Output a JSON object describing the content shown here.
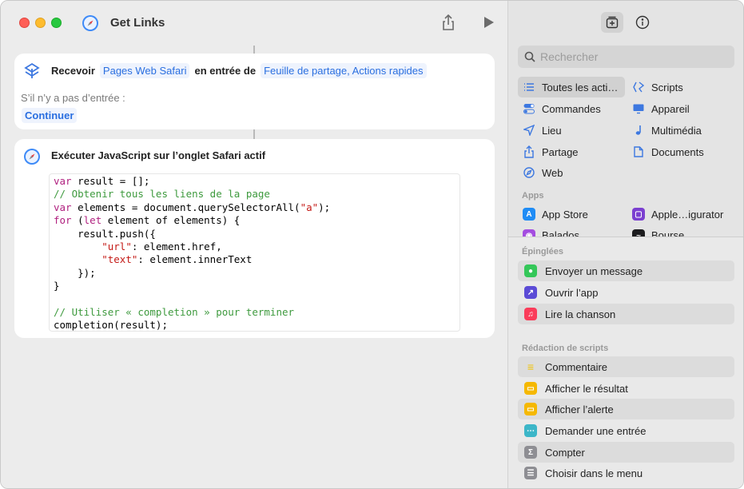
{
  "window": {
    "title": "Get Links"
  },
  "colors": {
    "accent": "#2a6fe0",
    "token_bg": "#eef3fd",
    "sidebar_bg": "#e4e4e4"
  },
  "toolbar": {
    "share_icon": "share-icon",
    "run_icon": "play-icon"
  },
  "receive_action": {
    "verb": "Recevoir",
    "input_types": "Pages Web Safari",
    "connector": "en entrée de",
    "sources": "Feuille de partage, Actions rapides",
    "no_input_label": "S’il n’y a pas d’entrée :",
    "no_input_action": "Continuer"
  },
  "js_action": {
    "title": "Exécuter JavaScript sur l’onglet Safari actif",
    "code": {
      "l1a": "var",
      "l1b": " result = [];",
      "l2": "// Obtenir tous les liens de la page",
      "l3a": "var",
      "l3b": " elements = document.querySelectorAll(",
      "l3c": "\"a\"",
      "l3d": ");",
      "l4a": "for",
      "l4b": " (",
      "l4c": "let",
      "l4d": " element of elements) {",
      "l5": "    result.push({",
      "l6a": "        ",
      "l6b": "\"url\"",
      "l6c": ": element.href,",
      "l7a": "        ",
      "l7b": "\"text\"",
      "l7c": ": element.innerText",
      "l8": "    });",
      "l9": "}",
      "l10": "",
      "l11": "// Utiliser « completion » pour terminer",
      "l12": "completion(result);"
    }
  },
  "sidebar": {
    "search_placeholder": "Rechercher",
    "categories_left": [
      "Toutes les acti…",
      "Commandes",
      "Lieu",
      "Partage",
      "Web"
    ],
    "categories_right": [
      "Scripts",
      "Appareil",
      "Multimédia",
      "Documents"
    ],
    "apps_label": "Apps",
    "apps": [
      "App Store",
      "Apple…igurator",
      "Balados",
      "Bourse"
    ],
    "pinned_label": "Épinglées",
    "pinned": [
      "Envoyer un message",
      "Ouvrir l’app",
      "Lire la chanson"
    ],
    "scripting_label": "Rédaction de scripts",
    "scripting": [
      "Commentaire",
      "Afficher le résultat",
      "Afficher l’alerte",
      "Demander une entrée",
      "Compter",
      "Choisir dans le menu"
    ]
  }
}
